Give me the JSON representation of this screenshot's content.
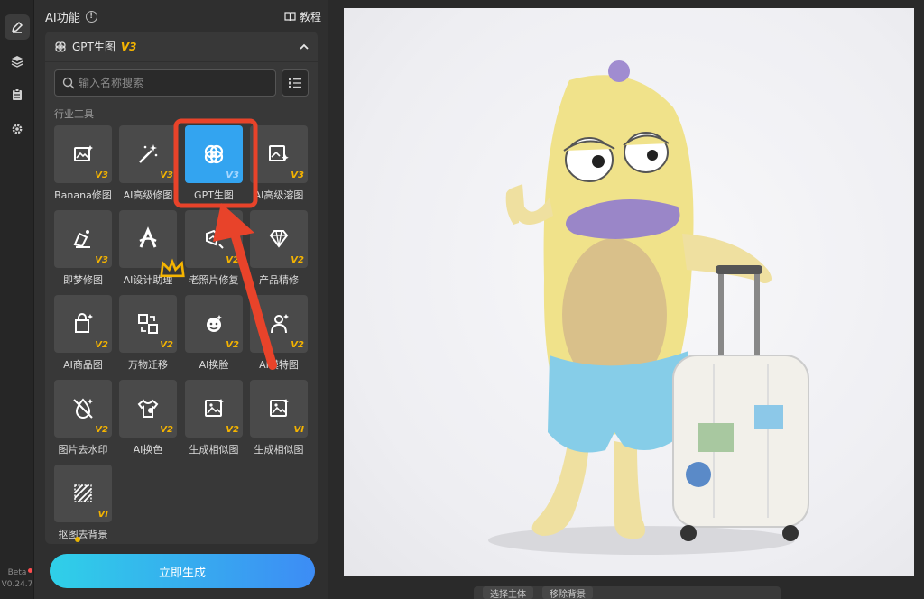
{
  "rail": {
    "items": [
      {
        "icon": "edit-icon"
      },
      {
        "icon": "layers-icon"
      },
      {
        "icon": "clipboard-icon"
      },
      {
        "icon": "gear-icon"
      }
    ],
    "beta_label": "Beta",
    "version": "V0.24.7"
  },
  "panel": {
    "title": "AI功能",
    "tutorial_label": "教程",
    "section": {
      "name": "GPT生图",
      "version": "V3"
    },
    "search_placeholder": "输入名称搜索",
    "category_label": "行业工具",
    "tools": [
      {
        "label": "Banana修图",
        "version": "V3",
        "icon": "image-spark-icon"
      },
      {
        "label": "AI高级修图",
        "version": "V3",
        "icon": "magic-wand-icon"
      },
      {
        "label": "GPT生图",
        "version": "V3",
        "icon": "gpt-knot-icon",
        "selected": true
      },
      {
        "label": "AI高级溶图",
        "version": "V3",
        "icon": "image-blend-icon"
      },
      {
        "label": "即梦修图",
        "version": "V3",
        "icon": "dream-edit-icon"
      },
      {
        "label": "AI设计助理",
        "version": "",
        "icon": "design-a-icon",
        "badge": "crown-icon"
      },
      {
        "label": "老照片修复",
        "version": "V2",
        "icon": "photo-repair-icon"
      },
      {
        "label": "产品精修",
        "version": "V2",
        "icon": "diamond-icon"
      },
      {
        "label": "AI商品图",
        "version": "V2",
        "icon": "shopping-bag-icon"
      },
      {
        "label": "万物迁移",
        "version": "V2",
        "icon": "transfer-icon"
      },
      {
        "label": "AI换脸",
        "version": "V2",
        "icon": "face-swap-icon"
      },
      {
        "label": "AI模特图",
        "version": "V2",
        "icon": "model-icon"
      },
      {
        "label": "图片去水印",
        "version": "V2",
        "icon": "watermark-remove-icon"
      },
      {
        "label": "AI换色",
        "version": "V2",
        "icon": "shirt-color-icon"
      },
      {
        "label": "生成相似图",
        "version": "V2",
        "icon": "similar-image-icon"
      },
      {
        "label": "生成相似图",
        "version": "VI",
        "icon": "similar-image-icon"
      },
      {
        "label": "抠图去背景",
        "version": "VI",
        "icon": "cutout-icon"
      }
    ],
    "generate_button": "立即生成"
  },
  "bottom_toolbar": {
    "select_subject": "选择主体",
    "remove_bg": "移除背景"
  },
  "colors": {
    "accent": "#33a4f0",
    "highlight": "#e8432a",
    "version_gold": "#f5b400"
  }
}
